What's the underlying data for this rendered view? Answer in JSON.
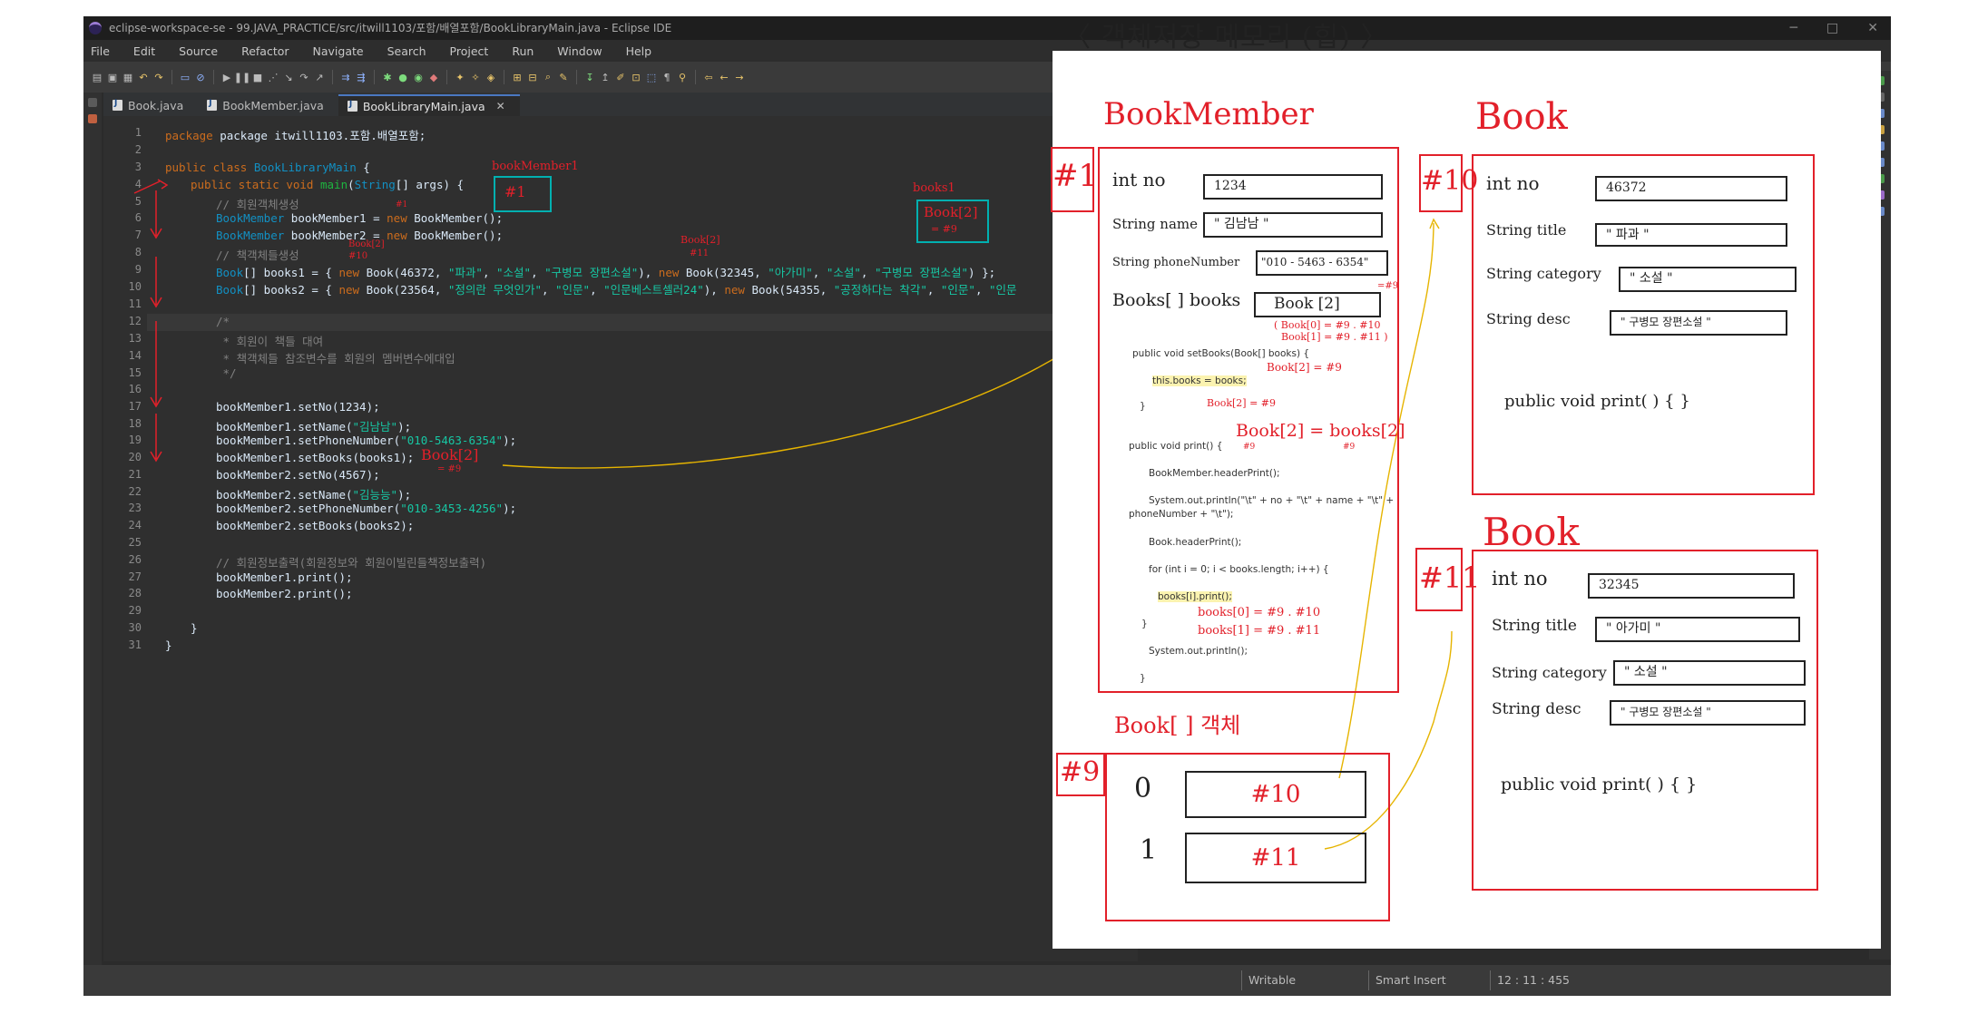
{
  "window": {
    "title": "eclipse-workspace-se - 99.JAVA_PRACTICE/src/itwill1103/포함/배열포함/BookLibraryMain.java - Eclipse IDE",
    "controls": [
      "─",
      "□",
      "✕"
    ]
  },
  "menu": [
    "File",
    "Edit",
    "Source",
    "Refactor",
    "Navigate",
    "Search",
    "Project",
    "Run",
    "Window",
    "Help"
  ],
  "tabs": [
    {
      "label": "Book.java",
      "active": false
    },
    {
      "label": "BookMember.java",
      "active": false
    },
    {
      "label": "BookLibraryMain.java",
      "active": true
    }
  ],
  "editor": {
    "line_numbers": [
      "1",
      "2",
      "3",
      "4",
      "5",
      "6",
      "7",
      "8",
      "9",
      "10",
      "11",
      "12",
      "13",
      "14",
      "15",
      "16",
      "17",
      "18",
      "19",
      "20",
      "21",
      "22",
      "23",
      "24",
      "25",
      "26",
      "27",
      "28",
      "29",
      "30",
      "31"
    ],
    "code": {
      "l1": "package itwill1103.포함.배열포함;",
      "l3a": "public class ",
      "l3b": "BookLibraryMain",
      "l3c": " {",
      "l4a": "public static void ",
      "l4b": "main",
      "l4c": "(",
      "l4d": "String",
      "l4e": "[] args) {",
      "l5": "// 회원객체생성",
      "l6a": "BookMember",
      "l6b": " bookMember1 = ",
      "l6c": "new",
      "l6d": " BookMember();",
      "l7a": "BookMember",
      "l7b": " bookMember2 = ",
      "l7c": "new",
      "l7d": " BookMember();",
      "l8": "// 책객체들생성",
      "l9a": "Book",
      "l9b": "[] books1 = { ",
      "l9c": "new",
      "l9d": " Book(46372, ",
      "l9e": "\"파과\"",
      "l9f": ", ",
      "l9g": "\"소설\"",
      "l9h": ", ",
      "l9i": "\"구병모 장편소설\"",
      "l9j": "), ",
      "l9k": "new",
      "l9l": " Book(32345, ",
      "l9m": "\"아가미\"",
      "l9n": ", ",
      "l9o": "\"소설\"",
      "l9p": ", ",
      "l9q": "\"구병모 장편소설\"",
      "l9r": ") };",
      "l10a": "Book",
      "l10b": "[] books2 = { ",
      "l10c": "new",
      "l10d": " Book(23564, ",
      "l10e": "\"정의란 무엇인가\"",
      "l10f": ", ",
      "l10g": "\"인문\"",
      "l10h": ", ",
      "l10i": "\"인문베스트셀러24\"",
      "l10j": "), ",
      "l10k": "new",
      "l10l": " Book(54355, ",
      "l10m": "\"공정하다는 착각\"",
      "l10n": ", ",
      "l10o": "\"인문\"",
      "l10p": ", ",
      "l10q": "\"인문",
      "l12": "/*",
      "l13": " * 회원이 책들 대여",
      "l14": " * 책객체들 참조변수를 회원의 멤버변수에대입",
      "l15": " */",
      "l17a": "bookMember1.setNo(1234);",
      "l18a": "bookMember1.setName(",
      "l18b": "\"김남남\"",
      "l18c": ");",
      "l19a": "bookMember1.setPhoneNumber(",
      "l19b": "\"010-5463-6354\"",
      "l19c": ");",
      "l20": "bookMember1.setBooks(books1);",
      "l21": "bookMember2.setNo(4567);",
      "l22a": "bookMember2.setName(",
      "l22b": "\"김능능\"",
      "l22c": ");",
      "l23a": "bookMember2.setPhoneNumber(",
      "l23b": "\"010-3453-4256\"",
      "l23c": ");",
      "l24": "bookMember2.setBooks(books2);",
      "l26": "// 회원정보출력(회원정보와 회원이빌린들책정보출력)",
      "l27": "bookMember1.print();",
      "l28": "bookMember2.print();",
      "l30": "}",
      "l31": "}"
    }
  },
  "code_annotations": {
    "bm1_label": "bookMember1",
    "bm1_box": "#1",
    "books1_label": "books1",
    "books1_box_l1": "Book[2]",
    "books1_box_l2": "= #9",
    "new1": "#1",
    "new2": "Book[2]",
    "new3": "#10",
    "new4": "Book[2]",
    "new5": "#11",
    "setbooks_l1": "Book[2]",
    "setbooks_l2": "= #9"
  },
  "status": {
    "writable": "Writable",
    "insert": "Smart Insert",
    "position": "12 : 11 : 455"
  },
  "whiteboard": {
    "title": "〈 객체저장 메모리 (힙) 〉",
    "member": {
      "heading": "BookMember",
      "id": "#1",
      "f1_label": "int  no",
      "f1_val": "1234",
      "f2_label": "String name",
      "f2_val": "\" 김남남 \"",
      "f3_label": "String phoneNumber",
      "f3_val": "\"010 - 5463 - 6354\"",
      "f4_label": "Books[ ]  books",
      "f4_val": "Book [2]",
      "f4_ref": "=#9",
      "n1": "( Book[0] = #9 . #10",
      "n2": "Book[1] = #9 . #11 )",
      "code_sb": "public void setBooks(Book[] books) {",
      "code_this": "this.books = books;",
      "code_close": "}",
      "note_a": "Book[2] = #9",
      "note_b": "Book[2] = #9",
      "note_eq": "Book[2] = books[2]",
      "note_eq1": "#9",
      "note_eq2": "#9",
      "code_pr": "public void print() {",
      "code_hp": "BookMember.headerPrint();",
      "code_sp1": "System.out.println(\"\\t\" + no + \"\\t\" + name + \"\\t\" +",
      "code_sp2": "phoneNumber + \"\\t\");",
      "code_bh": "Book.headerPrint();",
      "code_for": "for (int i = 0; i < books.length; i++) {",
      "code_bp": "books[i].print();",
      "code_c2": "}",
      "note_b0": "books[0] = #9 . #10",
      "note_b1": "books[1] = #9 . #11",
      "code_sln": "System.out.println();",
      "code_c3": "}"
    },
    "book1": {
      "heading": "Book",
      "id": "#10",
      "f1_label": "int  no",
      "f1_val": "46372",
      "f2_label": "String  title",
      "f2_val": "\" 파과 \"",
      "f3_label": "String  category",
      "f3_val": "\" 소설 \"",
      "f4_label": "String  desc",
      "f4_val": "\" 구병모 장편소설 \"",
      "method": "public void print( ) {      }"
    },
    "book2": {
      "heading": "Book",
      "id": "#11",
      "f1_label": "int  no",
      "f1_val": "32345",
      "f2_label": "String  title",
      "f2_val": "\" 아가미 \"",
      "f3_label": "String  category",
      "f3_val": "\" 소설 \"",
      "f4_label": "String  desc",
      "f4_val": "\" 구병모 장편소설 \"",
      "method": "public void print( ) {  }"
    },
    "array": {
      "heading": "Book[ ] 객체",
      "id": "#9",
      "idx0": "0",
      "val0": "#10",
      "idx1": "1",
      "val1": "#11"
    }
  }
}
